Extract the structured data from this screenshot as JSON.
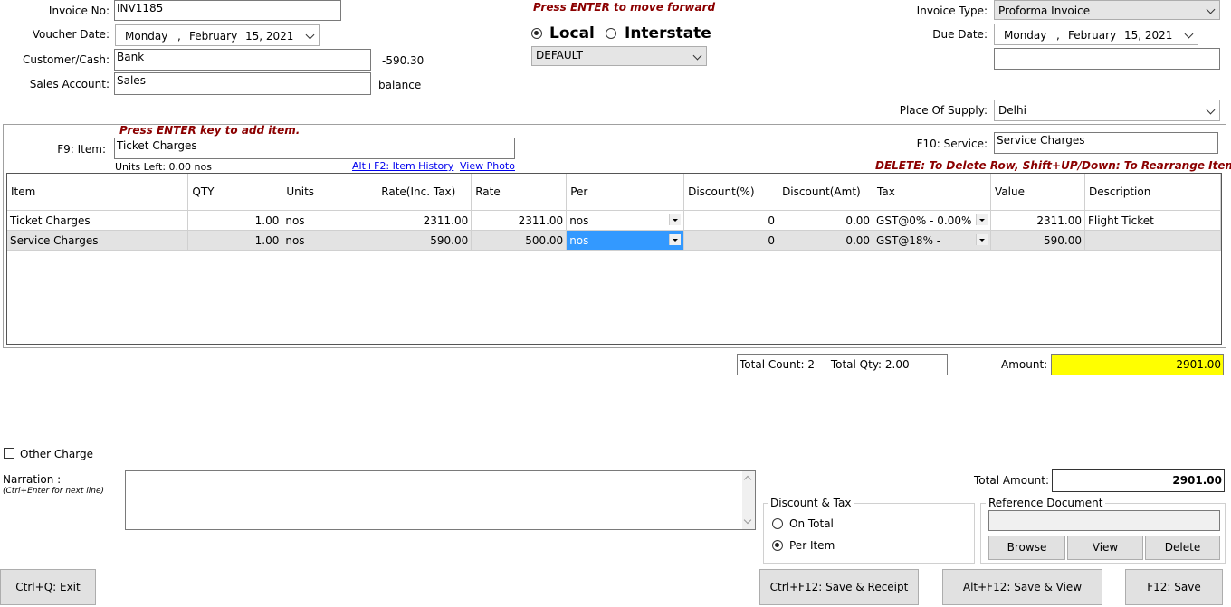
{
  "header": {
    "invoice_no_label": "Invoice No:",
    "invoice_no_value": "INV1185",
    "voucher_date_label": "Voucher Date:",
    "voucher_date": {
      "day": "Monday",
      "sep": ",",
      "month": "February",
      "date": "15, 2021"
    },
    "customer_label": "Customer/Cash:",
    "customer_value": "Bank",
    "customer_balance": "-590.30",
    "sales_account_label": "Sales Account:",
    "sales_account_value": "Sales",
    "balance_label": "balance",
    "enter_hint": "Press ENTER to move forward",
    "local_label": "Local",
    "interstate_label": "Interstate",
    "price_list_value": "DEFAULT",
    "invoice_type_label": "Invoice Type:",
    "invoice_type_value": "Proforma Invoice",
    "due_date_label": "Due Date:",
    "due_date": {
      "day": "Monday",
      "sep": ",",
      "month": "February",
      "date": "15, 2021"
    },
    "extra_field_value": "",
    "place_of_supply_label": "Place Of Supply:",
    "place_of_supply_value": "Delhi"
  },
  "items_panel": {
    "add_hint": "Press ENTER key to add item.",
    "item_label": "F9: Item:",
    "item_value": "Ticket Charges",
    "units_left": "Units Left: 0.00 nos",
    "item_history_link": "Alt+F2: Item History",
    "view_photo_link": "View Photo",
    "service_label": "F10: Service:",
    "service_value": "Service Charges",
    "delete_hint": "DELETE: To Delete Row, Shift+UP/Down: To Rearrange Items"
  },
  "grid": {
    "columns": [
      "Item",
      "QTY",
      "Units",
      "Rate(Inc. Tax)",
      "Rate",
      "Per",
      "Discount(%)",
      "Discount(Amt)",
      "Tax",
      "Value",
      "Description"
    ],
    "rows": [
      {
        "item": "Ticket Charges",
        "qty": "1.00",
        "units": "nos",
        "rate_inc": "2311.00",
        "rate": "2311.00",
        "per": "nos",
        "disc_pct": "0",
        "disc_amt": "0.00",
        "tax": "GST@0% - 0.00%",
        "value": "2311.00",
        "description": "Flight Ticket"
      },
      {
        "item": "Service Charges",
        "qty": "1.00",
        "units": "nos",
        "rate_inc": "590.00",
        "rate": "500.00",
        "per": "nos",
        "disc_pct": "0",
        "disc_amt": "0.00",
        "tax": "GST@18% -",
        "value": "590.00",
        "description": ""
      }
    ]
  },
  "totals": {
    "total_count_label": "Total Count:",
    "total_count": "2",
    "total_qty_label": "Total Qty:",
    "total_qty": "2.00",
    "amount_label": "Amount:",
    "amount_value": "2901.00",
    "total_amount_label": "Total Amount:",
    "total_amount_value": "2901.00"
  },
  "footer": {
    "other_charge_label": "Other Charge",
    "narration_label": "Narration :",
    "narration_hint": "(Ctrl+Enter for next line)",
    "narration_value": "",
    "discount_tax_title": "Discount & Tax",
    "on_total_label": "On Total",
    "per_item_label": "Per Item",
    "reference_title": "Reference Document",
    "reference_value": "",
    "browse_label": "Browse",
    "view_label": "View",
    "delete_label": "Delete",
    "exit_label": "Ctrl+Q: Exit",
    "save_receipt_label": "Ctrl+F12: Save & Receipt",
    "save_view_label": "Alt+F12: Save & View",
    "save_label": "F12: Save"
  },
  "colors": {
    "hint": "#8b0000",
    "amount_bg": "#ffff00",
    "selected_cell": "#3399ff",
    "link": "#0000ee"
  }
}
